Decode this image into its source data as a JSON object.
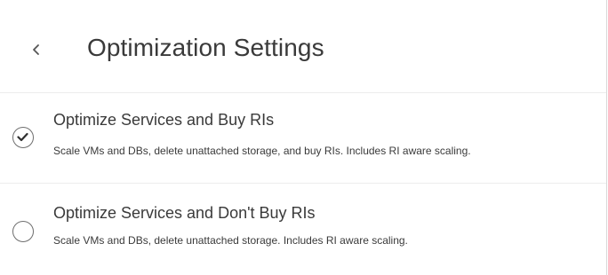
{
  "header": {
    "back_icon": "chevron-left-icon",
    "title": "Optimization Settings"
  },
  "options": [
    {
      "title": "Optimize Services and Buy RIs",
      "description": "Scale VMs and DBs, delete unattached storage, and buy RIs. Includes RI aware scaling.",
      "selected": true,
      "icon": "check-icon"
    },
    {
      "title": "Optimize Services and Don't Buy RIs",
      "description": "Scale VMs and DBs, delete unattached storage. Includes RI aware scaling.",
      "selected": false
    }
  ],
  "colors": {
    "text": "#3a3a3a",
    "radio_border": "#6e6e6e",
    "divider": "#ececec"
  }
}
